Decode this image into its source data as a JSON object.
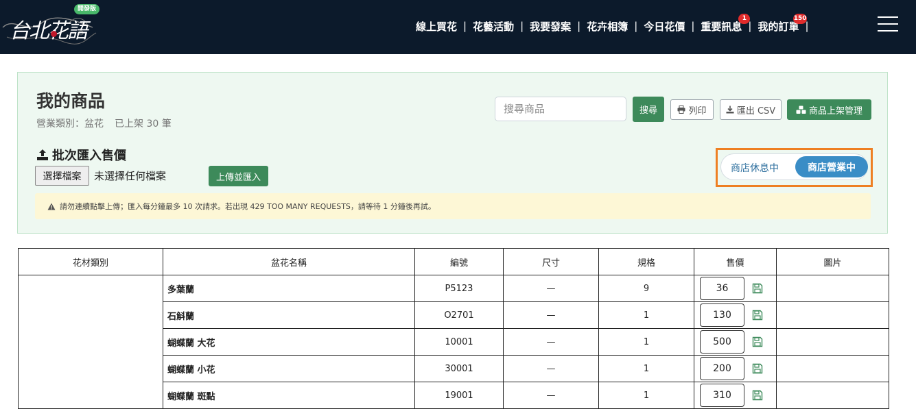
{
  "header": {
    "logo_text": "台北花語",
    "dev_badge": "開發版",
    "nav": [
      {
        "label": "線上買花",
        "badge": null
      },
      {
        "label": "花藝活動",
        "badge": null
      },
      {
        "label": "我要發案",
        "badge": null
      },
      {
        "label": "花卉相簿",
        "badge": null
      },
      {
        "label": "今日花價",
        "badge": null
      },
      {
        "label": "重要訊息",
        "badge": "1"
      },
      {
        "label": "我的訂單",
        "badge": "150"
      }
    ],
    "separator": "|"
  },
  "panel": {
    "title": "我的商品",
    "category": "營業類別：盆花",
    "listed": "已上架 30 筆",
    "search_placeholder": "搜尋商品",
    "search_value": "",
    "search_button": "搜尋",
    "print_button": "列印",
    "export_button": "匯出 CSV",
    "manage_button": "商品上架管理",
    "batch_title": "批次匯入售價",
    "file_button": "選擇檔案",
    "file_status": "未選擇任何檔案",
    "upload_button": "上傳並匯入",
    "toggle_off": "商店休息中",
    "toggle_on": "商店營業中",
    "alert": "請勿連續點擊上傳；匯入每分鐘最多 10 次請求。若出現 429 TOO MANY REQUESTS，請等待 1 分鐘後再試。"
  },
  "table": {
    "headers": [
      "花材類別",
      "盆花名稱",
      "編號",
      "尺寸",
      "規格",
      "售價",
      "圖片"
    ],
    "rows": [
      {
        "category": "",
        "name": "多葉蘭",
        "code": "P5123",
        "size": "—",
        "spec": "9",
        "price": "36",
        "image": ""
      },
      {
        "category": "",
        "name": "石斛蘭",
        "code": "O2701",
        "size": "—",
        "spec": "1",
        "price": "130",
        "image": ""
      },
      {
        "category": "",
        "name": "蝴蝶蘭 大花",
        "code": "10001",
        "size": "—",
        "spec": "1",
        "price": "500",
        "image": ""
      },
      {
        "category": "",
        "name": "蝴蝶蘭 小花",
        "code": "30001",
        "size": "—",
        "spec": "1",
        "price": "200",
        "image": ""
      },
      {
        "category": "",
        "name": "蝴蝶蘭 斑點",
        "code": "19001",
        "size": "—",
        "spec": "1",
        "price": "310",
        "image": ""
      }
    ]
  },
  "colors": {
    "nav_bg": "#0c1a2b",
    "accent_green": "#3d8a5a",
    "toggle_blue": "#3a8dc6",
    "highlight_orange": "#ee7f22",
    "badge_red": "#e02b2b"
  },
  "icons": {
    "print": "printer-icon",
    "export": "download-icon",
    "manage": "cubes-icon",
    "batch": "upload-icon",
    "alert": "warning-icon",
    "save": "floppy-disk-icon",
    "menu": "hamburger-menu-icon"
  }
}
